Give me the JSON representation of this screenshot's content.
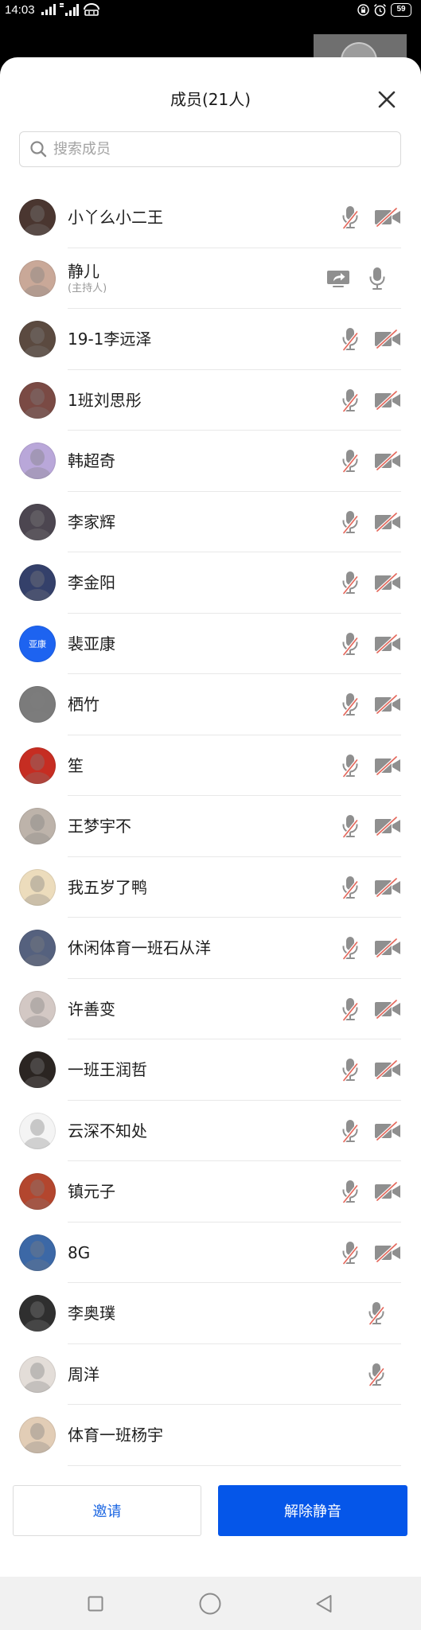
{
  "status_bar": {
    "time": "14:03",
    "battery": "59",
    "left_icons": [
      "signal-icon",
      "signal-4g-icon",
      "hd-icon"
    ],
    "right_icons": [
      "privacy-icon",
      "alarm-icon"
    ]
  },
  "header": {
    "title": "成员(21人)",
    "close_icon": "close-icon"
  },
  "search": {
    "placeholder": "搜索成员",
    "icon": "search-icon"
  },
  "members": [
    {
      "name": "小丫么小二王",
      "avatar_color": "#4a3630",
      "icons": [
        "mic-muted-icon",
        "video-off-icon"
      ]
    },
    {
      "name": "静儿",
      "role": "(主持人)",
      "avatar_color": "#c9a898",
      "icons": [
        "share-screen-icon",
        "mic-icon"
      ]
    },
    {
      "name": "19-1李远泽",
      "avatar_color": "#5b4a40",
      "icons": [
        "mic-muted-icon",
        "video-off-icon"
      ]
    },
    {
      "name": "1班刘思彤",
      "avatar_color": "#7a4a44",
      "icons": [
        "mic-muted-icon",
        "video-off-icon"
      ]
    },
    {
      "name": "韩超奇",
      "avatar_color": "#b9a7d9",
      "icons": [
        "mic-muted-icon",
        "video-off-icon"
      ]
    },
    {
      "name": "李家辉",
      "avatar_color": "#4c4650",
      "icons": [
        "mic-muted-icon",
        "video-off-icon"
      ]
    },
    {
      "name": "李金阳",
      "avatar_color": "#34406a",
      "icons": [
        "mic-muted-icon",
        "video-off-icon"
      ]
    },
    {
      "name": "裴亚康",
      "avatar_color": "#1d63f0",
      "avatar_text": "亚康",
      "icons": [
        "mic-muted-icon",
        "video-off-icon"
      ]
    },
    {
      "name": "栖竹",
      "avatar_color": "#7b7b7b",
      "icons": [
        "mic-muted-icon",
        "video-off-icon"
      ]
    },
    {
      "name": "笙",
      "avatar_color": "#c62d22",
      "icons": [
        "mic-muted-icon",
        "video-off-icon"
      ]
    },
    {
      "name": "王梦宇不",
      "avatar_color": "#bdb3aa",
      "icons": [
        "mic-muted-icon",
        "video-off-icon"
      ]
    },
    {
      "name": "我五岁了鸭",
      "avatar_color": "#ecdcbc",
      "icons": [
        "mic-muted-icon",
        "video-off-icon"
      ]
    },
    {
      "name": "休闲体育一班石从洋",
      "avatar_color": "#55617e",
      "icons": [
        "mic-muted-icon",
        "video-off-icon"
      ]
    },
    {
      "name": "许善变",
      "avatar_color": "#d3c8c4",
      "icons": [
        "mic-muted-icon",
        "video-off-icon"
      ]
    },
    {
      "name": "一班王润哲",
      "avatar_color": "#2b2522",
      "icons": [
        "mic-muted-icon",
        "video-off-icon"
      ]
    },
    {
      "name": "云深不知处",
      "avatar_color": "#f4f4f4",
      "icons": [
        "mic-muted-icon",
        "video-off-icon"
      ]
    },
    {
      "name": "镇元子",
      "avatar_color": "#b3462e",
      "icons": [
        "mic-muted-icon",
        "video-off-icon"
      ]
    },
    {
      "name": "8G",
      "avatar_color": "#3c68a6",
      "icons": [
        "mic-muted-icon",
        "video-off-icon"
      ]
    },
    {
      "name": "李奥璞",
      "avatar_color": "#2f2f2f",
      "icons": [
        "mic-muted-icon"
      ]
    },
    {
      "name": "周洋",
      "avatar_color": "#e3ddd8",
      "icons": [
        "mic-muted-icon"
      ]
    },
    {
      "name": "体育一班杨宇",
      "avatar_color": "#e2cdb6",
      "icons": []
    }
  ],
  "footer": {
    "invite_label": "邀请",
    "unmute_all_label": "解除静音"
  },
  "nav_bar": {
    "icons": [
      "recent-apps-icon",
      "home-icon",
      "back-icon"
    ]
  },
  "theme": {
    "primary": "#0556e9",
    "invite_text": "#1b66e2",
    "icon_gray": "#8f8f8f",
    "muted_slash": "#e4685c",
    "divider": "#e8e8e8"
  }
}
